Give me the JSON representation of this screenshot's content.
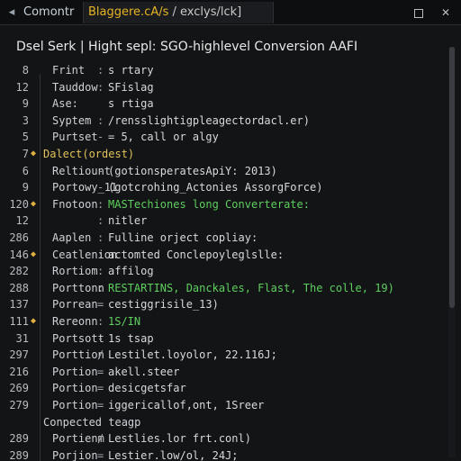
{
  "titlebar": {
    "back_icon": "back-arrow-icon",
    "tab_label": "Comontr",
    "breadcrumb_path": "Blaggere.cA/s",
    "breadcrumb_rest": " / exclys/lck]",
    "maximize_icon": "maximize-icon",
    "close_icon": "close-icon",
    "close_glyph": "✕"
  },
  "header": {
    "text": "Dsel Serk | Hight sepl: SGO-highlevel Conversion AAFI"
  },
  "lines": [
    {
      "num": "8",
      "fold": "",
      "key": "Frint",
      "sep": ":",
      "val": "s rtary",
      "style": ""
    },
    {
      "num": "12",
      "fold": "",
      "key": "Tauddow",
      "sep": ":",
      "val": "SFislag",
      "style": ""
    },
    {
      "num": "9",
      "fold": "",
      "key": "Ase:",
      "sep": "",
      "val": "s rtiga",
      "style": ""
    },
    {
      "num": "3",
      "fold": "",
      "key": "Syptem",
      "sep": ":",
      "val": "/rensslightigpleagectordacl.er)",
      "style": ""
    },
    {
      "num": "5",
      "fold": "",
      "key": "Purtset",
      "sep": "-",
      "val": "= 5, call or algy",
      "style": ""
    },
    {
      "num": "7",
      "fold": "◆",
      "key": "Dalect(ordest)",
      "sep": "",
      "val": "",
      "style": "yellow"
    },
    {
      "num": "6",
      "fold": "",
      "key": "Reltiount",
      "sep": "-",
      "val": "(gotionsperatesApiY: 2013)",
      "style": ""
    },
    {
      "num": "9",
      "fold": "",
      "key": "Portowy_11",
      "sep": "-",
      "val": "(gotcrohing_Actonies AssorgForce)",
      "style": ""
    },
    {
      "num": "120",
      "fold": "◆",
      "key": "Fnotoon",
      "sep": ":",
      "val": "MASTechiones long Converterate:",
      "style": "green-partial"
    },
    {
      "num": "12",
      "fold": "",
      "key": "",
      "sep": ":",
      "val": "nitler",
      "style": ""
    },
    {
      "num": "286",
      "fold": "",
      "key": "Aaplen",
      "sep": ":",
      "val": "Fulline orject copliay:",
      "style": ""
    },
    {
      "num": "146",
      "fold": "◆",
      "key": "Ceatlenion",
      "sep": ":",
      "val": "actomted Conclepoyleglslle:",
      "style": ""
    },
    {
      "num": "282",
      "fold": "",
      "key": "Rortiom",
      "sep": ":",
      "val": "affilog",
      "style": ""
    },
    {
      "num": "288",
      "fold": "",
      "key": "Porttonn",
      "sep": ":",
      "val": "RESTARTINS, Danckales, Flast, The colle, 19)",
      "style": "green-partial2"
    },
    {
      "num": "137",
      "fold": "",
      "key": "Porrean",
      "sep": "=",
      "val": "cestiggrisile_13)",
      "style": ""
    },
    {
      "num": "111",
      "fold": "◆",
      "key": "Rereonn",
      "sep": ":",
      "val": "1S/IN",
      "style": "green"
    },
    {
      "num": "31",
      "fold": "",
      "key": "Portsott",
      "sep": "-",
      "val": "1s tsap",
      "style": ""
    },
    {
      "num": "297",
      "fold": "",
      "key": "Porttion",
      "sep": "/",
      "val": "Lestilet.loyolor, 22.116J;",
      "style": ""
    },
    {
      "num": "216",
      "fold": "",
      "key": "Portion",
      "sep": "=",
      "val": "akell.steer",
      "style": ""
    },
    {
      "num": "269",
      "fold": "",
      "key": "Portion",
      "sep": "=",
      "val": "desicgetsfar",
      "style": ""
    },
    {
      "num": "279",
      "fold": "",
      "key": "Portion",
      "sep": "=",
      "val": "iggericallof,ont, 1Sreer",
      "style": ""
    },
    {
      "num": "",
      "fold": "",
      "key": "Conpected teagp",
      "sep": "",
      "val": "",
      "style": "section"
    },
    {
      "num": "289",
      "fold": "",
      "key": "Portienm",
      "sep": "/",
      "val": "Lestlies.lor frt.conl)",
      "style": ""
    },
    {
      "num": "289",
      "fold": "",
      "key": "Porjion",
      "sep": "=",
      "val": "Lestier.low/ol, 24J;",
      "style": ""
    }
  ],
  "colors": {
    "background": "#121416",
    "accent_yellow": "#e6b422",
    "accent_green": "#5fcf5f"
  }
}
